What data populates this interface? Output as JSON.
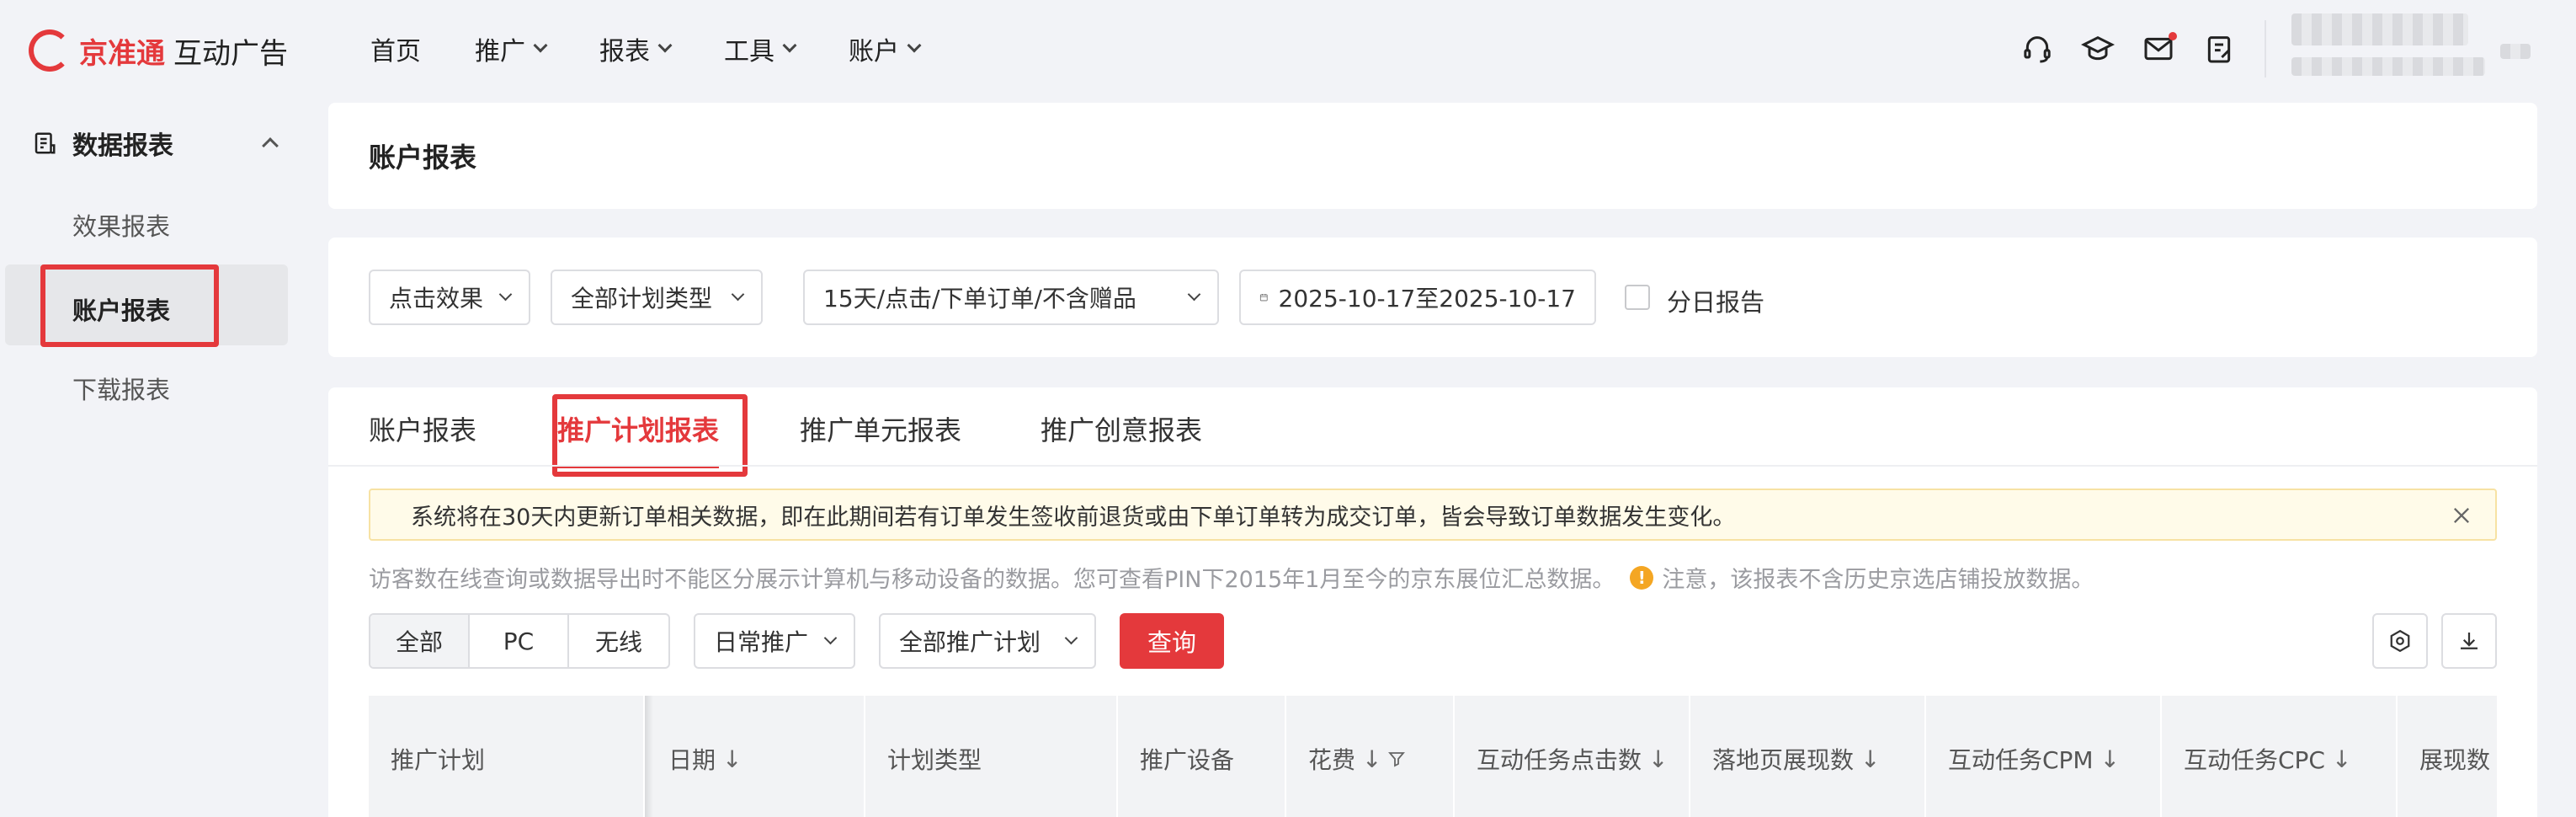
{
  "brand": {
    "name": "京准通",
    "product": "互动广告"
  },
  "topnav": {
    "items": [
      {
        "label": "首页",
        "has_dropdown": false
      },
      {
        "label": "推广",
        "has_dropdown": true
      },
      {
        "label": "报表",
        "has_dropdown": true
      },
      {
        "label": "工具",
        "has_dropdown": true
      },
      {
        "label": "账户",
        "has_dropdown": true
      }
    ],
    "icons": [
      "headset-icon",
      "graduation-cap-icon",
      "mail-icon",
      "clipboard-icon"
    ],
    "mail_has_unread": true
  },
  "sidebar": {
    "group_label": "数据报表",
    "items": [
      {
        "label": "效果报表",
        "active": false
      },
      {
        "label": "账户报表",
        "active": true
      },
      {
        "label": "下载报表",
        "active": false
      }
    ]
  },
  "page": {
    "title": "账户报表"
  },
  "filters": {
    "effect_type": "点击效果",
    "plan_type": "全部计划类型",
    "attribution": "15天/点击/下单订单/不含赠品",
    "date_range": "2025-10-17至2025-10-17",
    "daily_report_label": "分日报告",
    "daily_report_checked": false
  },
  "tabs": [
    {
      "label": "账户报表",
      "active": false
    },
    {
      "label": "推广计划报表",
      "active": true
    },
    {
      "label": "推广单元报表",
      "active": false
    },
    {
      "label": "推广创意报表",
      "active": false
    }
  ],
  "notice": "系统将在30天内更新订单相关数据，即在此期间若有订单发生签收前退货或由下单订单转为成交订单，皆会导致订单数据发生变化。",
  "info": {
    "text": "访客数在线查询或数据导出时不能区分展示计算机与移动设备的数据。您可查看PIN下2015年1月至今的京东展位汇总数据。",
    "warning_glyph": "!",
    "warning": "注意，该报表不含历史京选店铺投放数据。"
  },
  "toolbar": {
    "device_segments": [
      {
        "label": "全部",
        "active": true
      },
      {
        "label": "PC",
        "active": false
      },
      {
        "label": "无线",
        "active": false
      }
    ],
    "promo_type": "日常推广",
    "plan_filter": "全部推广计划",
    "query_label": "查询"
  },
  "table": {
    "columns": [
      {
        "label": "推广计划",
        "sortable": false,
        "filter": false
      },
      {
        "label": "日期",
        "sortable": true,
        "filter": false
      },
      {
        "label": "计划类型",
        "sortable": false,
        "filter": false
      },
      {
        "label": "推广设备",
        "sortable": false,
        "filter": false
      },
      {
        "label": "花费",
        "sortable": true,
        "filter": true
      },
      {
        "label": "互动任务点击数",
        "sortable": true,
        "filter": false
      },
      {
        "label": "落地页展现数",
        "sortable": true,
        "filter": false
      },
      {
        "label": "互动任务CPM",
        "sortable": true,
        "filter": false
      },
      {
        "label": "互动任务CPC",
        "sortable": true,
        "filter": false
      },
      {
        "label": "展现数",
        "sortable": true,
        "filter": false
      }
    ],
    "sort_glyph": "↓"
  },
  "colors": {
    "accent": "#e4393c",
    "page_bg": "#f2f3f7",
    "notice_bg": "#fffbe9",
    "warning": "#f4a623"
  }
}
